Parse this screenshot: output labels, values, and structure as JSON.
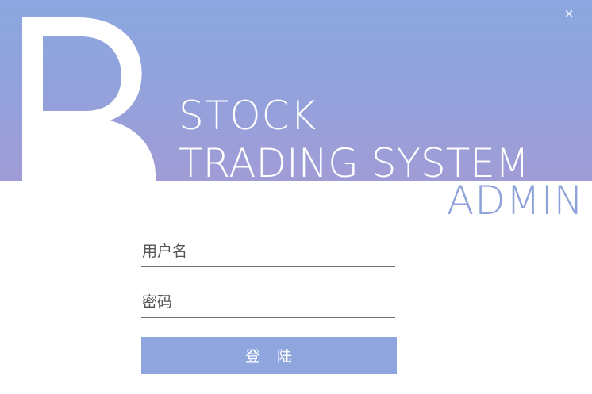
{
  "window": {
    "close_glyph": "×"
  },
  "banner": {
    "logo_letter": "B",
    "title_line1": "STOCK",
    "title_line2": "TRADING SYSTEM",
    "subtitle": "ADMIN",
    "gradient_top": "#8aa7df",
    "gradient_bottom": "#a19cd6",
    "admin_color": "#8ea2da"
  },
  "form": {
    "username": {
      "value": "",
      "placeholder": "用户名"
    },
    "password": {
      "value": "",
      "placeholder": "密码"
    },
    "login_label": "登　陆",
    "button_color": "#8ea5dd"
  }
}
